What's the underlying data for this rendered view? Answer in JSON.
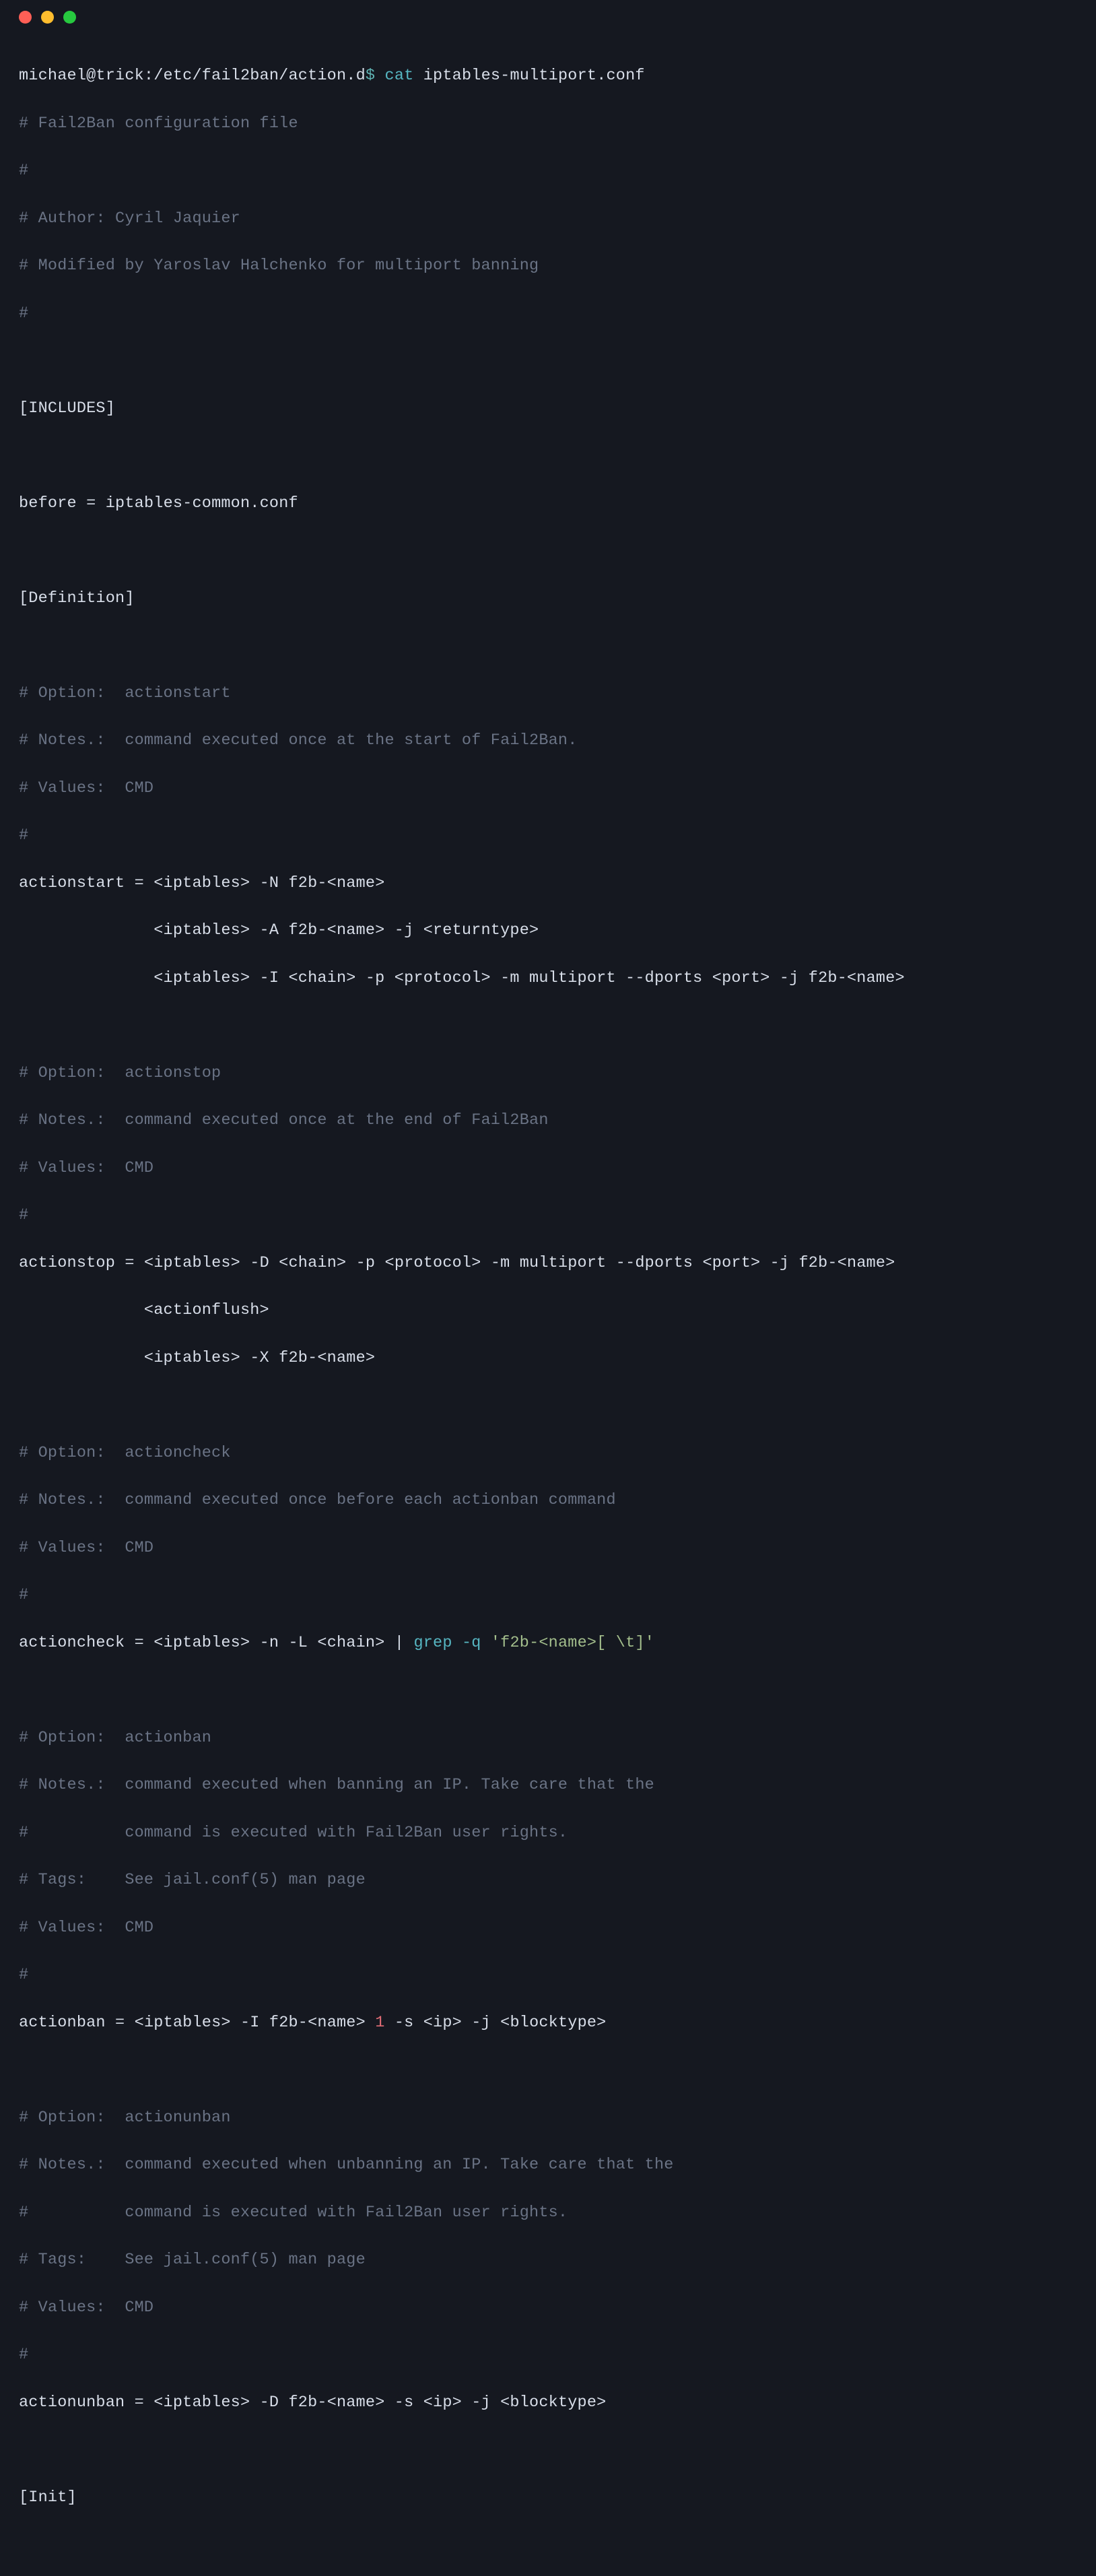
{
  "titlebar": {
    "close": "close",
    "minimize": "minimize",
    "maximize": "maximize"
  },
  "prompt": {
    "userhost": "michael@trick:/etc/fail2ban/action.d",
    "dollar": "$",
    "command": "cat",
    "arg": "iptables-multiport.conf"
  },
  "lines": {
    "l00": "# Fail2Ban configuration file",
    "l01": "#",
    "l02": "# Author: Cyril Jaquier",
    "l03": "# Modified by Yaroslav Halchenko for multiport banning",
    "l04": "#",
    "l05": "",
    "l06a": "[INCLUDES]",
    "l07": "",
    "l08a": "before",
    "l08b": " = ",
    "l08c": "iptables-common.conf",
    "l09": "",
    "l10a": "[Definition]",
    "l11": "",
    "l12": "# Option:  actionstart",
    "l13": "# Notes.:  command executed once at the start of Fail2Ban.",
    "l14": "# Values:  CMD",
    "l15": "#",
    "l16a": "actionstart",
    "l16b": " = ",
    "l16c": "<iptables> -N f2b-<name>",
    "l17": "              <iptables> -A f2b-<name> -j <returntype>",
    "l18": "              <iptables> -I <chain> -p <protocol> -m multiport --dports <port> -j f2b-<name>",
    "l19": "",
    "l20": "# Option:  actionstop",
    "l21": "# Notes.:  command executed once at the end of Fail2Ban",
    "l22": "# Values:  CMD",
    "l23": "#",
    "l24a": "actionstop",
    "l24b": " = ",
    "l24c": "<iptables> -D <chain> -p <protocol> -m multiport --dports <port> -j f2b-<name>",
    "l25": "             <actionflush>",
    "l26": "             <iptables> -X f2b-<name>",
    "l27": "",
    "l28": "# Option:  actioncheck",
    "l29": "# Notes.:  command executed once before each actionban command",
    "l30": "# Values:  CMD",
    "l31": "#",
    "l32a": "actioncheck",
    "l32b": " = ",
    "l32c": "<iptables> -n -L <chain>",
    "l32d": " | ",
    "l32e": "grep -q ",
    "l32f": "'f2b-<name>[ \\t]'",
    "l33": "",
    "l34": "# Option:  actionban",
    "l35": "# Notes.:  command executed when banning an IP. Take care that the",
    "l36": "#          command is executed with Fail2Ban user rights.",
    "l37": "# Tags:    See jail.conf(5) man page",
    "l38": "# Values:  CMD",
    "l39": "#",
    "l40a": "actionban",
    "l40b": " = ",
    "l40c": "<iptables> -I f2b-<name> ",
    "l40d": "1",
    "l40e": " -s <ip> -j <blocktype>",
    "l41": "",
    "l42": "# Option:  actionunban",
    "l43": "# Notes.:  command executed when unbanning an IP. Take care that the",
    "l44": "#          command is executed with Fail2Ban user rights.",
    "l45": "# Tags:    See jail.conf(5) man page",
    "l46": "# Values:  CMD",
    "l47": "#",
    "l48a": "actionunban",
    "l48b": " = ",
    "l48c": "<iptables> -D f2b-<name> -s <ip> -j <blocktype>",
    "l49": "",
    "l50a": "[Init]"
  }
}
